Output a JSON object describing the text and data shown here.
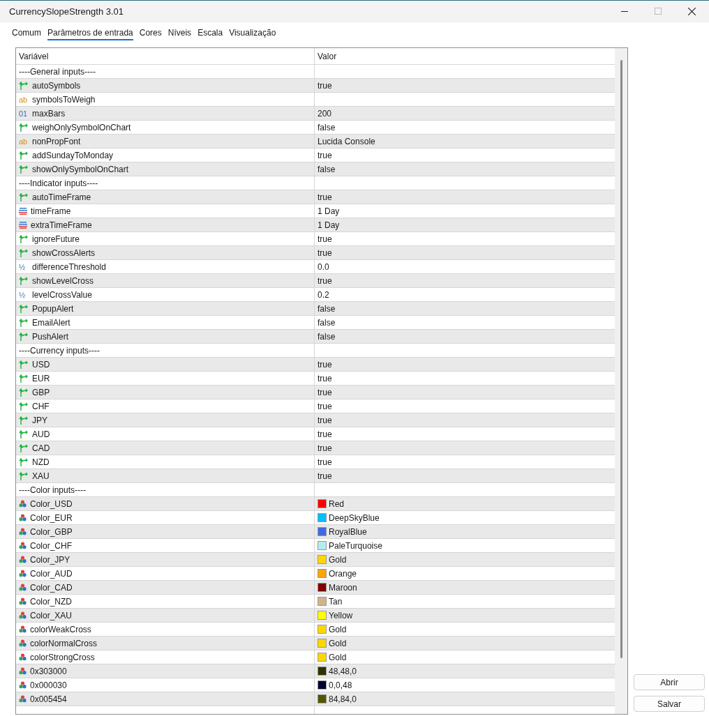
{
  "window": {
    "title": "CurrencySlopeStrength 3.01"
  },
  "tabs": [
    {
      "label": "Comum",
      "selected": false
    },
    {
      "label": "Parâmetros de entrada",
      "selected": true
    },
    {
      "label": "Cores",
      "selected": false
    },
    {
      "label": "Níveis",
      "selected": false
    },
    {
      "label": "Escala",
      "selected": false
    },
    {
      "label": "Visualização",
      "selected": false
    }
  ],
  "table": {
    "columns": [
      "Variável",
      "Valor"
    ],
    "rows": [
      {
        "kind": "group",
        "name": "----General inputs----"
      },
      {
        "kind": "bool",
        "name": "autoSymbols",
        "value": "true"
      },
      {
        "kind": "string",
        "icon_text": "ab",
        "name": "symbolsToWeigh"
      },
      {
        "kind": "int",
        "icon_text": "01",
        "name": "maxBars",
        "value": "200"
      },
      {
        "kind": "bool",
        "name": "weighOnlySymbolOnChart",
        "value": "false"
      },
      {
        "kind": "string",
        "icon_text": "ab",
        "name": "nonPropFont",
        "value": "Lucida Console"
      },
      {
        "kind": "bool",
        "name": "addSundayToMonday",
        "value": "true"
      },
      {
        "kind": "bool",
        "name": "showOnlySymbolOnChart",
        "value": "false"
      },
      {
        "kind": "group",
        "name": "----Indicator inputs----"
      },
      {
        "kind": "bool",
        "name": "autoTimeFrame",
        "value": "true"
      },
      {
        "kind": "enum",
        "name": "timeFrame",
        "value": "1 Day"
      },
      {
        "kind": "enum",
        "name": "extraTimeFrame",
        "value": "1 Day"
      },
      {
        "kind": "bool",
        "name": "ignoreFuture",
        "value": "true"
      },
      {
        "kind": "bool",
        "name": "showCrossAlerts",
        "value": "true"
      },
      {
        "kind": "double",
        "icon_text": "½",
        "name": "differenceThreshold",
        "value": "0.0"
      },
      {
        "kind": "bool",
        "name": "showLevelCross",
        "value": "true"
      },
      {
        "kind": "double",
        "icon_text": "½",
        "name": "levelCrossValue",
        "value": "0.2"
      },
      {
        "kind": "bool",
        "name": "PopupAlert",
        "value": "false"
      },
      {
        "kind": "bool",
        "name": "EmailAlert",
        "value": "false"
      },
      {
        "kind": "bool",
        "name": "PushAlert",
        "value": "false"
      },
      {
        "kind": "group",
        "name": "----Currency inputs----"
      },
      {
        "kind": "bool",
        "name": "USD",
        "value": "true"
      },
      {
        "kind": "bool",
        "name": "EUR",
        "value": "true"
      },
      {
        "kind": "bool",
        "name": "GBP",
        "value": "true"
      },
      {
        "kind": "bool",
        "name": "CHF",
        "value": "true"
      },
      {
        "kind": "bool",
        "name": "JPY",
        "value": "true"
      },
      {
        "kind": "bool",
        "name": "AUD",
        "value": "true"
      },
      {
        "kind": "bool",
        "name": "CAD",
        "value": "true"
      },
      {
        "kind": "bool",
        "name": "NZD",
        "value": "true"
      },
      {
        "kind": "bool",
        "name": "XAU",
        "value": "true"
      },
      {
        "kind": "group",
        "name": "----Color inputs----"
      },
      {
        "kind": "color",
        "name": "Color_USD",
        "value": "Red",
        "color": "#ff0000"
      },
      {
        "kind": "color",
        "name": "Color_EUR",
        "value": "DeepSkyBlue",
        "color": "#00bfff"
      },
      {
        "kind": "color",
        "name": "Color_GBP",
        "value": "RoyalBlue",
        "color": "#4169e1"
      },
      {
        "kind": "color",
        "name": "Color_CHF",
        "value": "PaleTurquoise",
        "color": "#afeeee"
      },
      {
        "kind": "color",
        "name": "Color_JPY",
        "value": "Gold",
        "color": "#ffd700"
      },
      {
        "kind": "color",
        "name": "Color_AUD",
        "value": "Orange",
        "color": "#ffa500"
      },
      {
        "kind": "color",
        "name": "Color_CAD",
        "value": "Maroon",
        "color": "#800000"
      },
      {
        "kind": "color",
        "name": "Color_NZD",
        "value": "Tan",
        "color": "#d2b48c"
      },
      {
        "kind": "color",
        "name": "Color_XAU",
        "value": "Yellow",
        "color": "#ffff00"
      },
      {
        "kind": "color",
        "name": "colorWeakCross",
        "value": "Gold",
        "color": "#ffd700"
      },
      {
        "kind": "color",
        "name": "colorNormalCross",
        "value": "Gold",
        "color": "#ffd700"
      },
      {
        "kind": "color",
        "name": "colorStrongCross",
        "value": "Gold",
        "color": "#ffd700"
      },
      {
        "kind": "color",
        "name": "0x303000",
        "value": "48,48,0",
        "color": "#303000"
      },
      {
        "kind": "color",
        "name": "0x000030",
        "value": "0,0,48",
        "color": "#000030"
      },
      {
        "kind": "color",
        "name": "0x005454",
        "value": "84,84,0",
        "color": "#545400"
      }
    ]
  },
  "buttons": [
    "Abrir",
    "Salvar"
  ]
}
